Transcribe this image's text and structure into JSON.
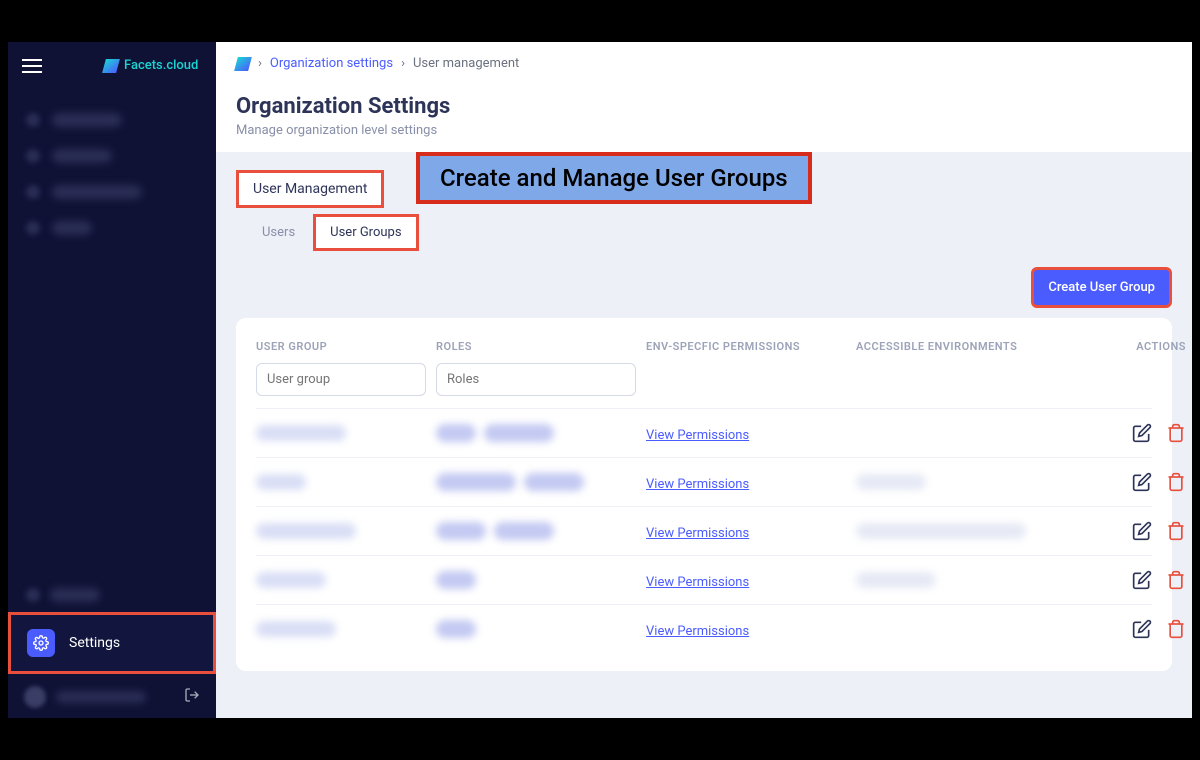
{
  "brand": "Facets.cloud",
  "breadcrumb": {
    "root": "Organization settings",
    "leaf": "User management",
    "sep": "›"
  },
  "page": {
    "title": "Organization Settings",
    "subtitle": "Manage organization level settings"
  },
  "annotation": "Create and Manage User Groups",
  "tabs": {
    "primary": "User Management",
    "sub_users": "Users",
    "sub_groups": "User Groups"
  },
  "buttons": {
    "create": "Create User Group"
  },
  "table": {
    "headers": {
      "group": "USER GROUP",
      "roles": "ROLES",
      "perms": "ENV-SPECFIC PERMISSIONS",
      "envs": "ACCESSIBLE ENVIRONMENTS",
      "actions": "ACTIONS"
    },
    "filters": {
      "group_placeholder": "User group",
      "roles_placeholder": "Roles"
    },
    "perm_link": "View Permissions",
    "rows": [
      {
        "name_w": 90,
        "pills": [
          40,
          70
        ],
        "env_w": 0
      },
      {
        "name_w": 50,
        "pills": [
          80,
          60
        ],
        "env_w": 70
      },
      {
        "name_w": 100,
        "pills": [
          50,
          60
        ],
        "env_w": 170
      },
      {
        "name_w": 70,
        "pills": [
          40
        ],
        "env_w": 80
      },
      {
        "name_w": 80,
        "pills": [
          40
        ],
        "env_w": 0
      }
    ]
  },
  "sidebar": {
    "settings": "Settings"
  }
}
